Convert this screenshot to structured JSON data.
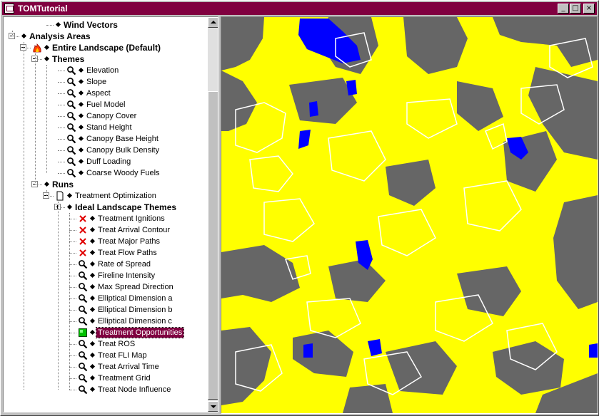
{
  "window": {
    "title": "TOMTutorial",
    "controls": {
      "minimize": "_",
      "maximize": "□",
      "close": "×"
    }
  },
  "tree": {
    "items": [
      {
        "label": "Wind Vectors",
        "bold": true,
        "icon": "none"
      },
      {
        "label": "Analysis Areas",
        "bold": true,
        "icon": "none",
        "toggle": "minus"
      },
      {
        "label": "Entire Landscape (Default)",
        "bold": true,
        "icon": "fire-icon",
        "toggle": "minus"
      },
      {
        "label": "Themes",
        "bold": true,
        "icon": "none",
        "toggle": "minus"
      },
      {
        "label": "Elevation",
        "icon": "magnifier-icon"
      },
      {
        "label": "Slope",
        "icon": "magnifier-icon"
      },
      {
        "label": "Aspect",
        "icon": "magnifier-icon"
      },
      {
        "label": "Fuel Model",
        "icon": "magnifier-icon"
      },
      {
        "label": "Canopy Cover",
        "icon": "magnifier-icon"
      },
      {
        "label": "Stand Height",
        "icon": "magnifier-icon"
      },
      {
        "label": "Canopy Base Height",
        "icon": "magnifier-icon"
      },
      {
        "label": "Canopy Bulk Density",
        "icon": "magnifier-icon"
      },
      {
        "label": "Duff Loading",
        "icon": "magnifier-icon"
      },
      {
        "label": "Coarse Woody Fuels",
        "icon": "magnifier-icon"
      },
      {
        "label": "Runs",
        "bold": true,
        "icon": "none",
        "toggle": "minus"
      },
      {
        "label": "Treatment Optimization",
        "icon": "document-icon",
        "toggle": "minus"
      },
      {
        "label": "Ideal Landscape Themes",
        "bold": true,
        "icon": "none",
        "toggle": "plus"
      },
      {
        "label": "Treatment Ignitions",
        "icon": "red-x-icon"
      },
      {
        "label": "Treat Arrival Contour",
        "icon": "red-x-icon"
      },
      {
        "label": "Treat Major Paths",
        "icon": "red-x-icon"
      },
      {
        "label": "Treat Flow Paths",
        "icon": "red-x-icon"
      },
      {
        "label": "Rate of Spread",
        "icon": "magnifier-icon"
      },
      {
        "label": "Fireline Intensity",
        "icon": "magnifier-icon"
      },
      {
        "label": "Max Spread Direction",
        "icon": "magnifier-icon"
      },
      {
        "label": "Elliptical Dimension a",
        "icon": "magnifier-icon"
      },
      {
        "label": "Elliptical Dimension b",
        "icon": "magnifier-icon"
      },
      {
        "label": "Elliptical Dimension c",
        "icon": "magnifier-icon"
      },
      {
        "label": "Treatment Opportunities",
        "icon": "green-square-icon",
        "selected": true
      },
      {
        "label": "Treat ROS",
        "icon": "magnifier-icon"
      },
      {
        "label": "Treat FLI Map",
        "icon": "magnifier-icon"
      },
      {
        "label": "Treat Arrival Time",
        "icon": "magnifier-icon"
      },
      {
        "label": "Treatment Grid",
        "icon": "magnifier-icon"
      },
      {
        "label": "Treat Node Influence",
        "icon": "magnifier-icon"
      }
    ]
  },
  "map": {
    "name": "Treatment Opportunities",
    "colors": {
      "opportunity": "#ffff00",
      "non_opportunity": "#666666",
      "water": "#0000ff",
      "contour": "#ffffff"
    }
  },
  "colors": {
    "titlebar": "#800040",
    "selection": "#800040",
    "window_face": "#c0c0c0"
  }
}
